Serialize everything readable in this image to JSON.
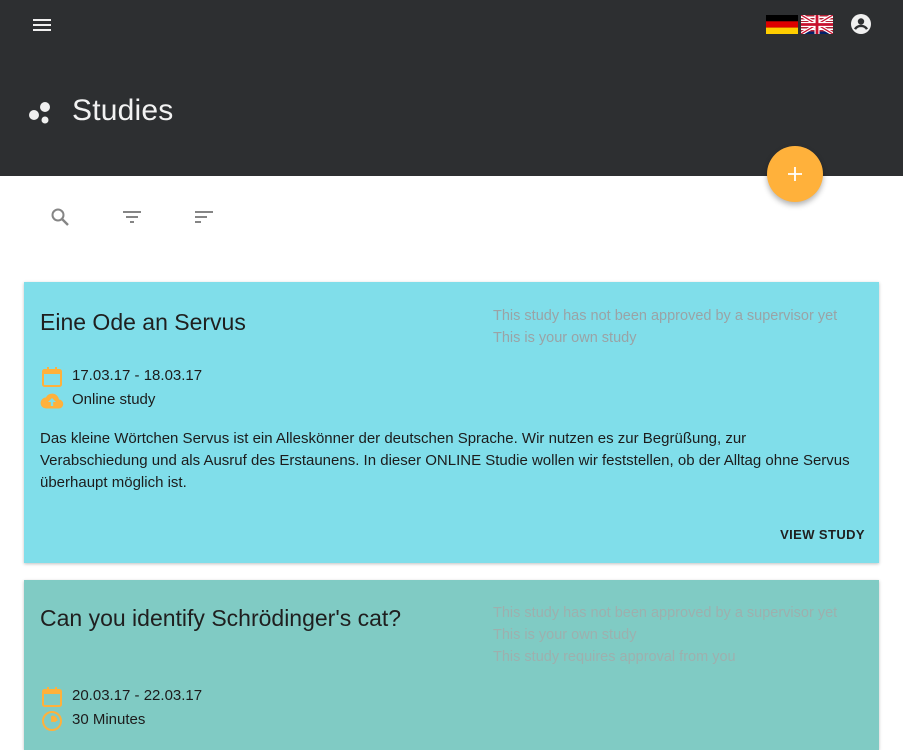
{
  "header": {
    "title": "Studies",
    "menu_icon": "menu-icon",
    "title_icon": "bubbles-icon",
    "languages": [
      {
        "name": "German",
        "icon": "flag-de-icon"
      },
      {
        "name": "English",
        "icon": "flag-gb-us-icon"
      }
    ],
    "account_icon": "account-circle-icon"
  },
  "fab": {
    "icon": "plus-icon",
    "color": "#ffb13b"
  },
  "toolbar": {
    "search_icon": "search-icon",
    "filter_icon": "filter-icon",
    "sort_icon": "sort-icon"
  },
  "studies": [
    {
      "title": "Eine Ode an Servus",
      "statuses": [
        "This study has not been approved by a supervisor yet",
        "This is your own study"
      ],
      "date": "17.03.17 - 18.03.17",
      "location": "Online study",
      "description": "Das kleine Wörtchen Servus ist ein Alleskönner der deutschen Sprache. Wir nutzen es zur Begrüßung, zur Verabschiedung und als Ausruf des Erstaunens. In dieser ONLINE Studie wollen wir feststellen, ob der Alltag ohne Servus überhaupt möglich ist.",
      "action": "VIEW STUDY",
      "color": "#80deea"
    },
    {
      "title": "Can you identify Schrödinger's cat?",
      "statuses": [
        "This study has not been approved by a supervisor yet",
        "This is your own study",
        "This study requires approval from you"
      ],
      "date": "20.03.17 - 22.03.17",
      "duration": "30 Minutes",
      "color": "#80cbc4"
    }
  ],
  "colors": {
    "appbar": "#2d2f31",
    "accent": "#ffb13b",
    "meta_icon": "#ffb13b"
  }
}
